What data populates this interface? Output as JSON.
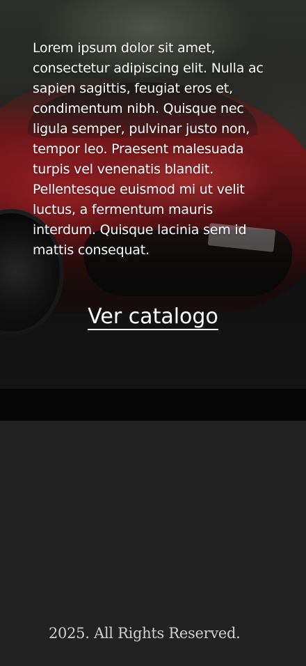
{
  "hero": {
    "description": "Lorem ipsum dolor sit amet, consectetur adipiscing elit. Nulla ac sapien sagittis, feugiat eros et, condimentum nibh. Quisque nec ligula semper, pulvinar justo non, tempor leo. Praesent malesuada turpis vel venenatis blandit. Pellentesque euismod mi ut velit luctus, a fermentum mauris interdum. Quisque lacinia sem id mattis consequat.",
    "cta_label": "Ver catalogo",
    "background_accent": "#b8242b"
  },
  "footer": {
    "copyright": "2025. All Rights Reserved.",
    "background": "#222222"
  }
}
